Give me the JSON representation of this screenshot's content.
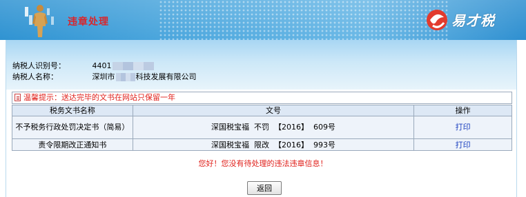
{
  "banner": {
    "title": "违章处理",
    "logo_text": "易才税",
    "icons": {
      "figure": "person-figure-icon",
      "logo": "etax-logo-icon"
    }
  },
  "taxpayer": {
    "id_label": "纳税人识别号：",
    "id_value": "4401",
    "name_label": "纳税人名称：",
    "name_prefix": "深圳市",
    "name_suffix": "科技发展有限公司"
  },
  "notice": {
    "icon": "memo-icon",
    "text": "温馨提示：送达完毕的文书在网站只保留一年"
  },
  "table": {
    "headers": [
      "税务文书名称",
      "文号",
      "操作"
    ],
    "rows": [
      {
        "name": "不予税务行政处罚决定书（简易）",
        "doc_no": "深国税宝福  不罚  【2016】  609号",
        "action": "打印"
      },
      {
        "name": "责令限期改正通知书",
        "doc_no": "深国税宝福  限改  【2016】  993号",
        "action": "打印"
      }
    ]
  },
  "message": "您好！您没有待处理的违法违章信息！",
  "back_button": "返回",
  "colors": {
    "banner_blue": "#2f93d2",
    "title_red": "#d8262c",
    "alert_red": "#e0201b",
    "link_blue": "#1a3fbf",
    "table_border": "#9aa9bb"
  }
}
